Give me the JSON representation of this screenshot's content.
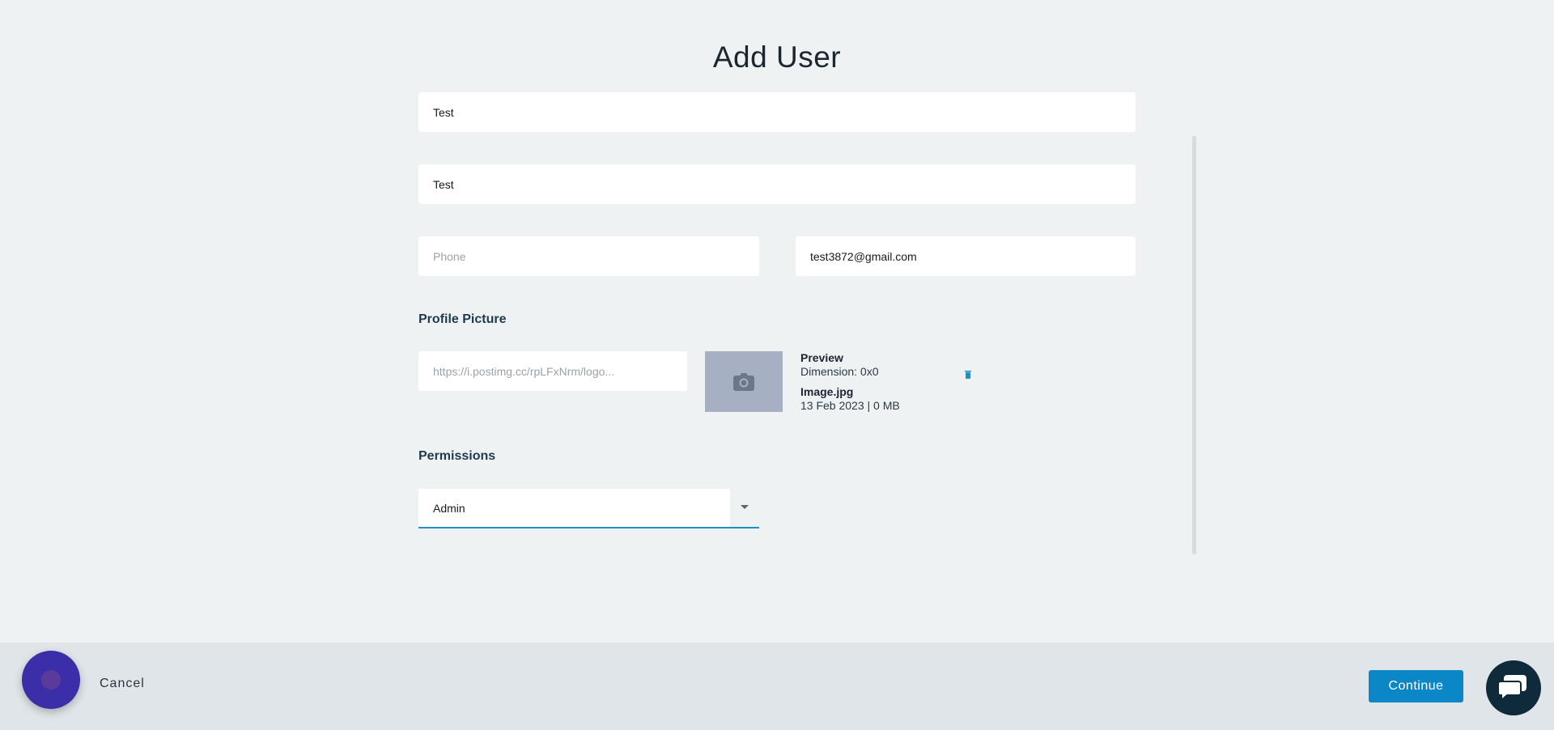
{
  "page": {
    "title": "Add User"
  },
  "form": {
    "first_name": {
      "value": "Test"
    },
    "last_name": {
      "value": "Test"
    },
    "phone": {
      "placeholder": "Phone",
      "value": ""
    },
    "email": {
      "value": "test3872@gmail.com"
    }
  },
  "profile_picture": {
    "label": "Profile Picture",
    "url_value": "https://i.postimg.cc/rpLFxNrm/logo...",
    "preview_title": "Preview",
    "dimension": "Dimension: 0x0",
    "filename": "Image.jpg",
    "file_meta": "13 Feb 2023 | 0 MB",
    "camera_icon": "camera-icon",
    "trash_icon": "trash-icon"
  },
  "permissions": {
    "label": "Permissions",
    "selected": "Admin"
  },
  "footer": {
    "cancel_label": "Cancel",
    "continue_label": "Continue"
  },
  "colors": {
    "accent": "#0b87c8",
    "background": "#eef2f3",
    "footer": "#dfe5e8"
  }
}
